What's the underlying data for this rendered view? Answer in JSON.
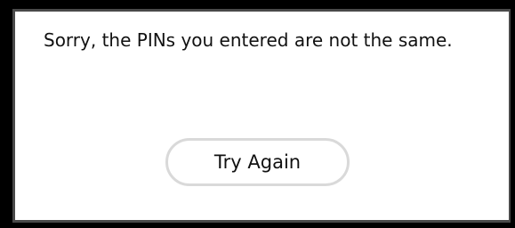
{
  "dialog": {
    "message": "Sorry, the PINs you entered are not the same.",
    "button_label": "Try Again"
  },
  "colors": {
    "background": "#000000",
    "panel": "#ffffff",
    "panel_border": "#4a4a4a",
    "text": "#111111",
    "button_border": "#d9d9d9"
  }
}
